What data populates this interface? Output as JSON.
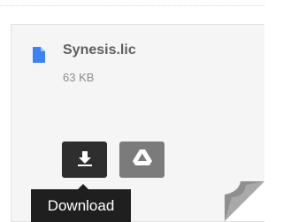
{
  "file": {
    "name": "Synesis.lic",
    "size": "63 KB",
    "icon": "file-document-icon"
  },
  "actions": {
    "download_icon": "download-arrow-icon",
    "drive_icon": "google-drive-icon"
  },
  "tooltip": {
    "text": "Download"
  },
  "colors": {
    "file_icon": "#3b82f6",
    "download_button": "#2e2e2e",
    "drive_button": "#7b7b7b",
    "tooltip_bg": "#1f1f1f",
    "card_bg": "#f5f5f5"
  }
}
